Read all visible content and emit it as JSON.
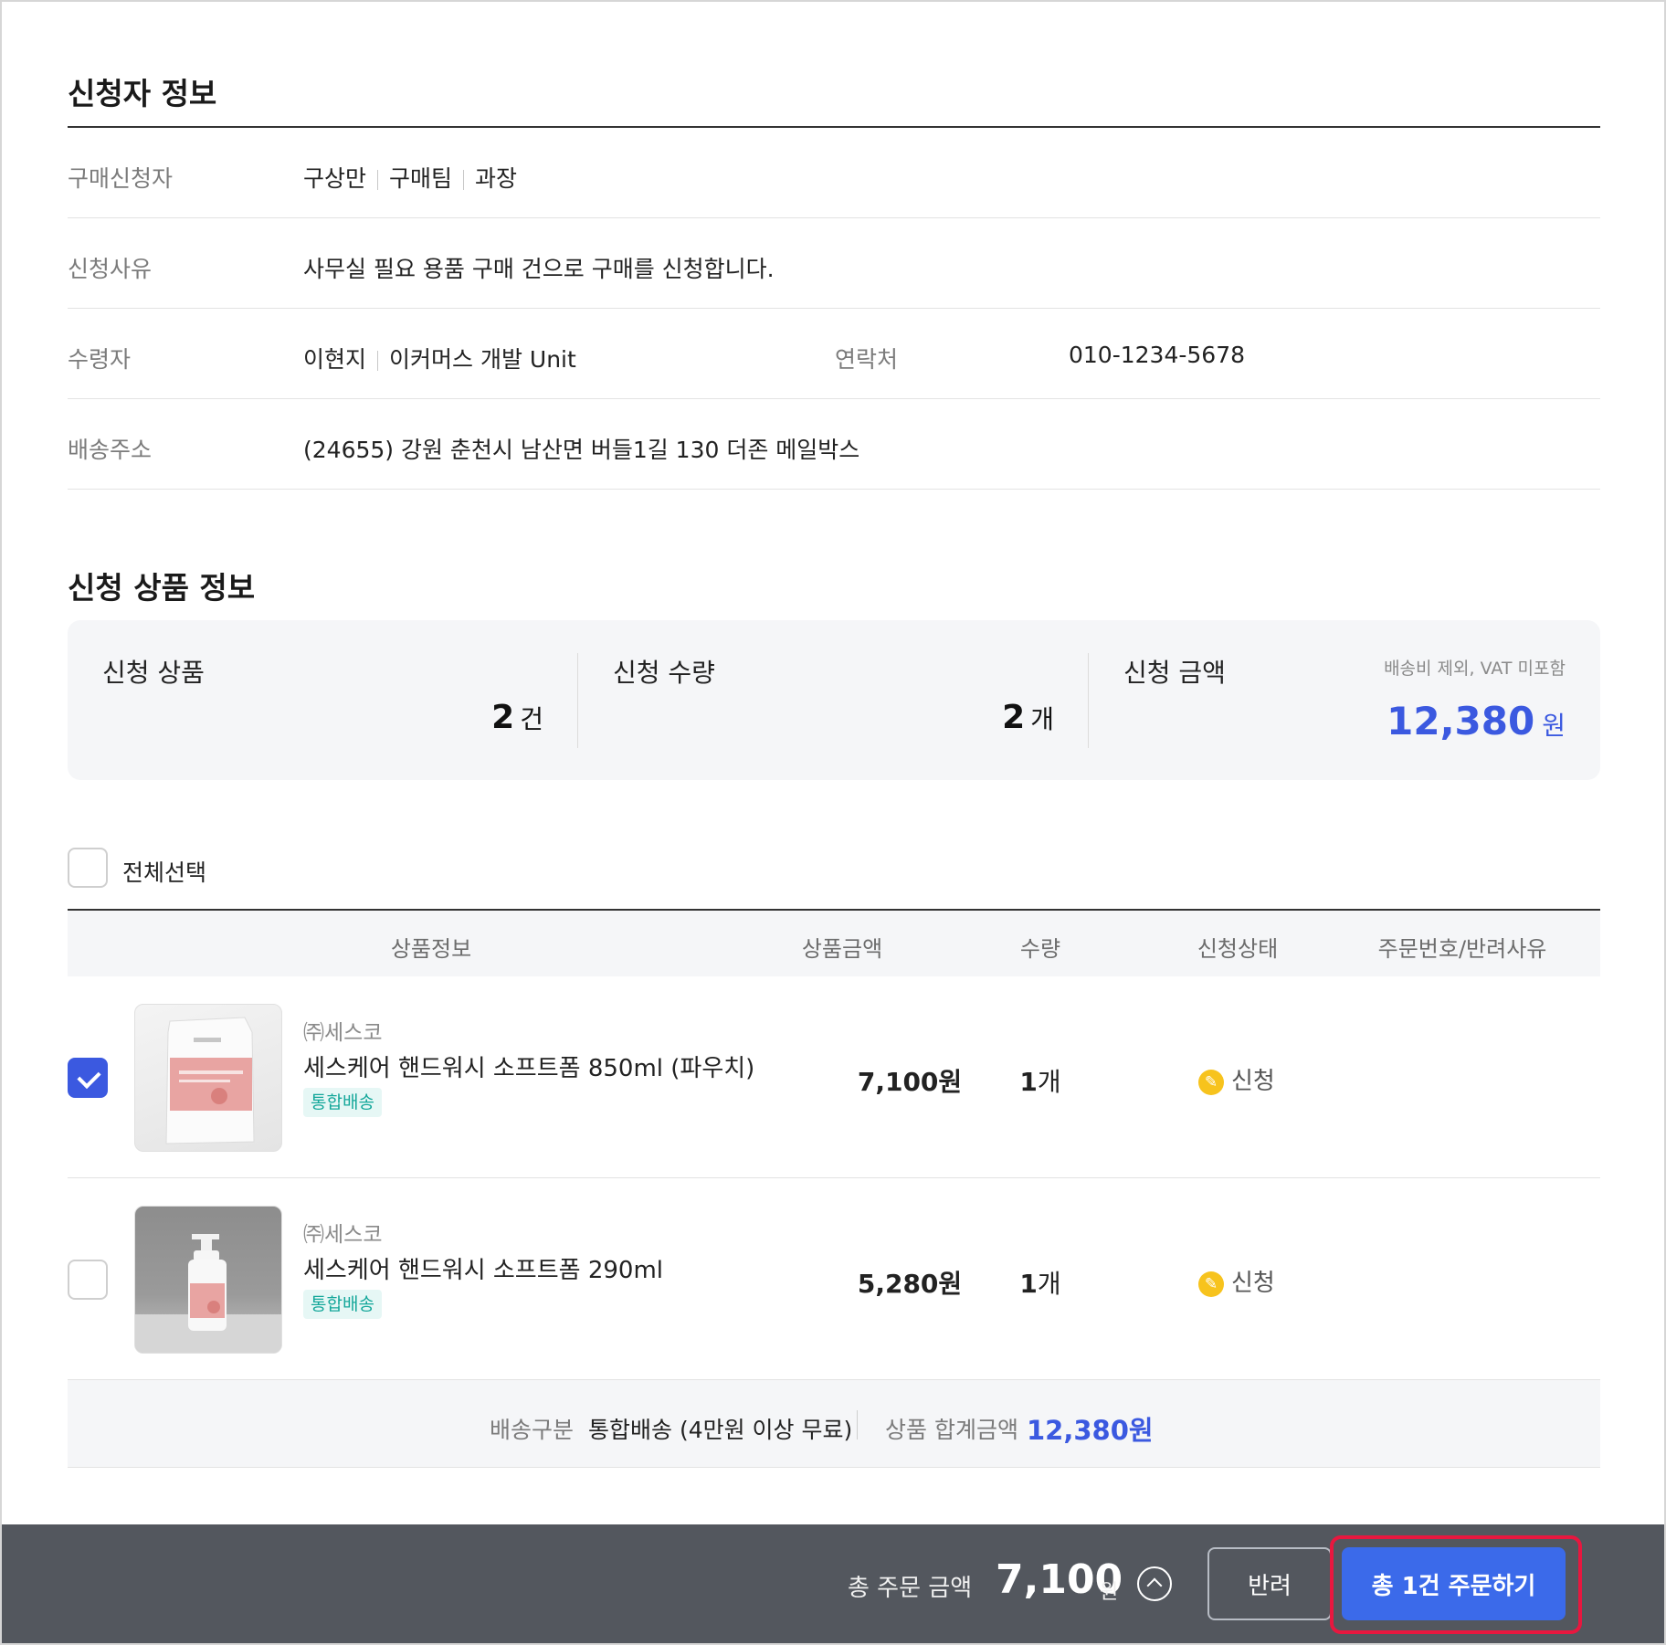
{
  "applicant_section": {
    "title": "신청자 정보",
    "rows": {
      "purchaser": {
        "label": "구매신청자",
        "name": "구상만",
        "team": "구매팀",
        "position": "과장"
      },
      "reason": {
        "label": "신청사유",
        "value": "사무실 필요 용품 구매 건으로 구매를 신청합니다."
      },
      "receiver": {
        "label": "수령자",
        "name": "이현지",
        "team": "이커머스 개발 Unit",
        "contact_label": "연락처",
        "contact": "010-1234-5678"
      },
      "address": {
        "label": "배송주소",
        "value": "(24655) 강원 춘천시 남산면 버들1길 130 더존 메일박스"
      }
    }
  },
  "product_section": {
    "title": "신청 상품 정보",
    "summary": {
      "items": {
        "label": "신청 상품",
        "value": "2",
        "unit": "건"
      },
      "quantity": {
        "label": "신청 수량",
        "value": "2",
        "unit": "개"
      },
      "amount": {
        "label": "신청 금액",
        "note": "배송비 제외, VAT 미포함",
        "value": "12,380",
        "unit": "원"
      }
    },
    "select_all_label": "전체선택",
    "columns": [
      "상품정보",
      "상품금액",
      "수량",
      "신청상태",
      "주문번호/반려사유"
    ],
    "products": [
      {
        "checked": true,
        "brand": "㈜세스코",
        "name": "세스케어 핸드워시 소프트폼 850ml (파우치)",
        "tag": "통합배송",
        "price": "7,100원",
        "qty": "1",
        "qty_unit": "개",
        "status": "신청",
        "status_icon": "pencil-icon"
      },
      {
        "checked": false,
        "brand": "㈜세스코",
        "name": "세스케어 핸드워시 소프트폼 290ml",
        "tag": "통합배송",
        "price": "5,280원",
        "qty": "1",
        "qty_unit": "개",
        "status": "신청",
        "status_icon": "pencil-icon"
      }
    ],
    "delivery": {
      "type_label": "배송구분",
      "type_value": "통합배송 (4만원 이상 무료)",
      "total_label": "상품 합계금액",
      "total_value": "12,380원"
    }
  },
  "footer": {
    "total_label": "총 주문 금액",
    "total_amount": "7,100",
    "total_unit": "원",
    "reject_label": "반려",
    "order_label": "총 1건 주문하기"
  },
  "colors": {
    "accent": "#3b59e0",
    "order_button": "#3b6aea",
    "footer_bg": "#53575e",
    "highlight": "#e8173f",
    "tag_text": "#14a79a",
    "status_icon": "#f7c31d"
  }
}
